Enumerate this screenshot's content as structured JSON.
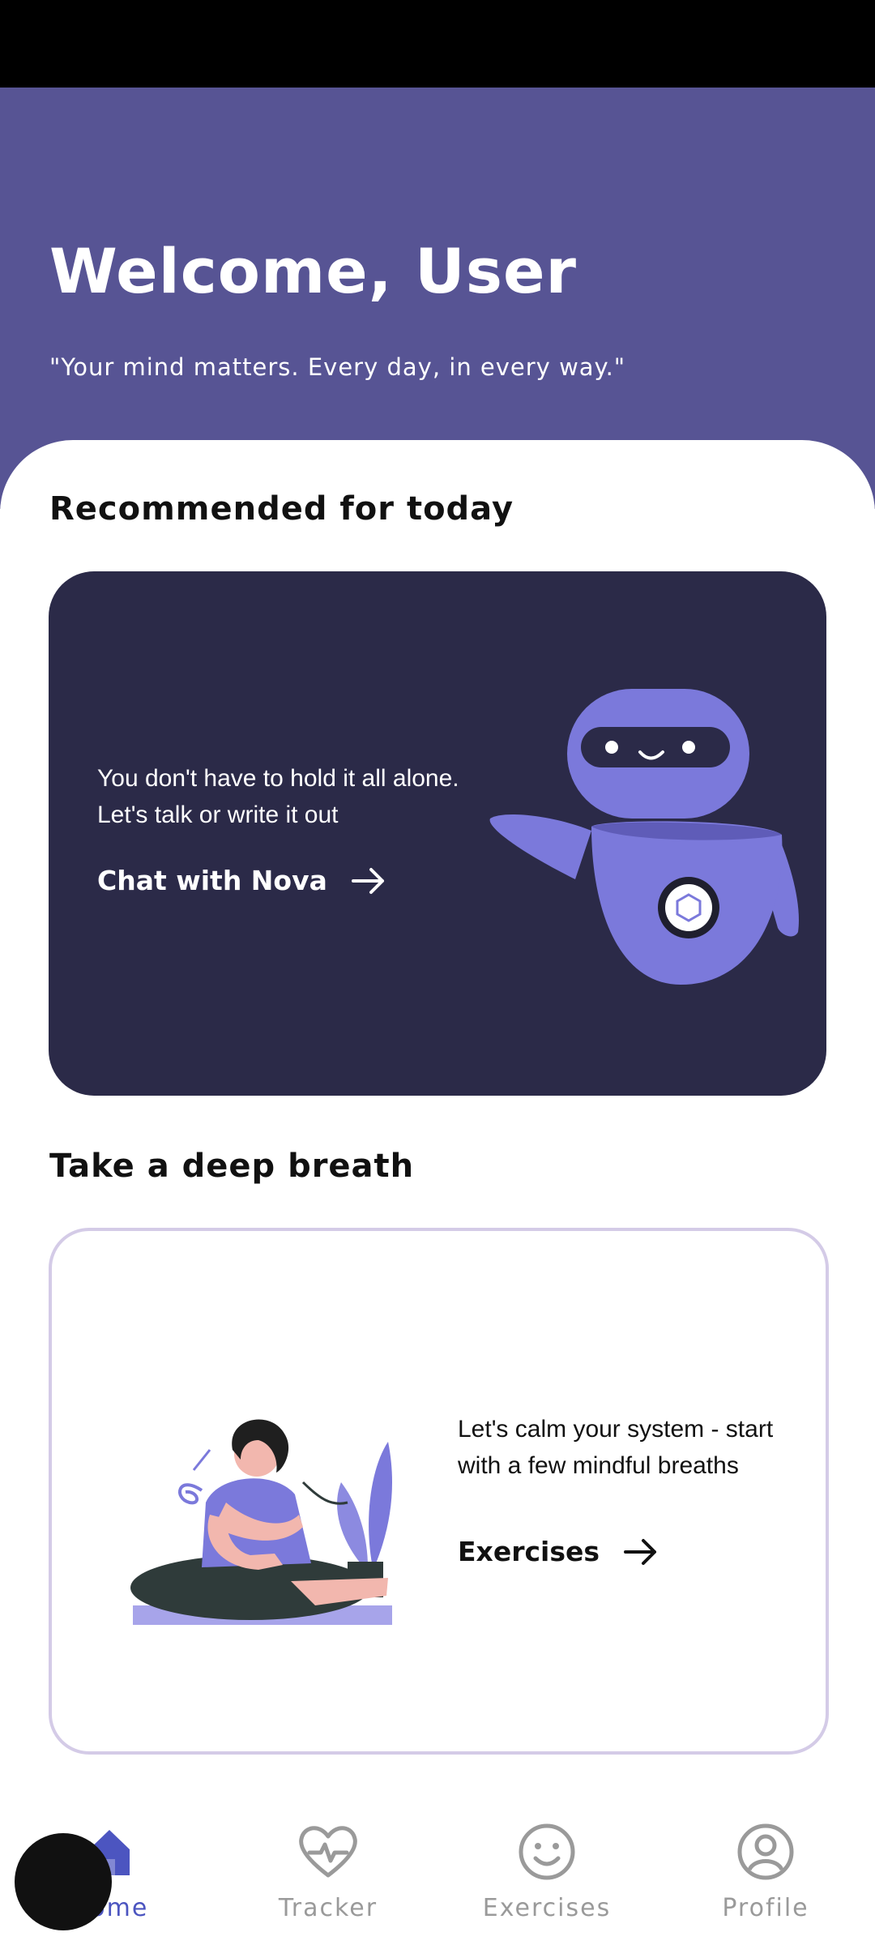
{
  "header": {
    "title": "Welcome, User",
    "quote": "\"Your mind matters. Every day, in every way.\""
  },
  "sections": {
    "recommended_title": "Recommended for today",
    "breath_title": "Take a deep breath"
  },
  "nova_card": {
    "message": "You don't have to hold it all alone. Let's talk or write it out",
    "link_label": "Chat with Nova"
  },
  "breath_card": {
    "message": "Let's calm your system - start with a few mindful breaths",
    "link_label": "Exercises"
  },
  "nav": {
    "items": [
      {
        "label": "Home",
        "icon": "home-icon",
        "active": true
      },
      {
        "label": "Tracker",
        "icon": "heartbeat-icon",
        "active": false
      },
      {
        "label": "Exercises",
        "icon": "smiley-icon",
        "active": false
      },
      {
        "label": "Profile",
        "icon": "profile-icon",
        "active": false
      }
    ]
  },
  "colors": {
    "header": "#575494",
    "card_dark": "#2b2a48",
    "accent": "#7b79db",
    "nav_active": "#4c55c0",
    "nav_inactive": "#9a9a9a",
    "card_border": "#d4cbe7"
  }
}
